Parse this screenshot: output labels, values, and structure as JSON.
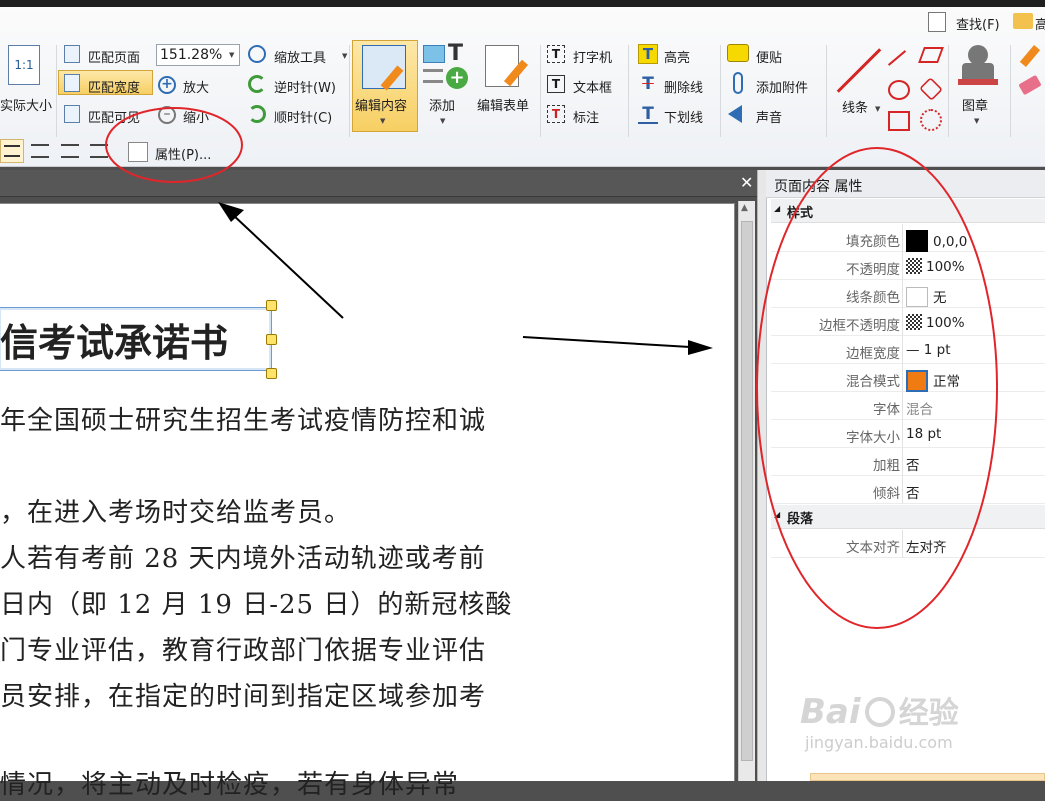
{
  "toolbar": {
    "search_label": "查找(F)",
    "search_next": "高",
    "actual_size": "实际大小",
    "fit_page": "匹配页面",
    "fit_width": "匹配宽度",
    "fit_visible": "匹配可见",
    "zoom_value": "151.28%",
    "zoom_tool": "缩放工具",
    "zoom_in": "放大",
    "zoom_out": "缩小",
    "rotate_ccw": "逆时针(W)",
    "rotate_cw": "顺时针(C)",
    "edit_content": "编辑内容",
    "add": "添加",
    "edit_form": "编辑表单",
    "typewriter": "打字机",
    "textbox": "文本框",
    "callout": "标注",
    "highlight": "高亮",
    "strikeout": "删除线",
    "underline": "下划线",
    "sticky_note": "便贴",
    "attach_file": "添加附件",
    "sound": "声音",
    "line": "线条",
    "stamp": "图章",
    "properties": "属性(P)..."
  },
  "document": {
    "title_text": "信考试承诺书",
    "lines": [
      "年全国硕士研究生招生考试疫情防控和诚",
      "，在进入考场时交给监考员。",
      "人若有考前 28 天内境外活动轨迹或考前",
      "日内（即 12 月 19 日-25 日）的新冠核酸",
      "门专业评估，教育行政部门依据专业评估",
      "员安排，在指定的时间到指定区域参加考",
      "情况，将主动及时检疫，若有身体异常"
    ]
  },
  "panel": {
    "header": "页面内容 属性",
    "section_style": "样式",
    "section_para": "段落",
    "rows": [
      {
        "name": "填充颜色",
        "value": "0,0,0"
      },
      {
        "name": "不透明度",
        "value": "100%"
      },
      {
        "name": "线条颜色",
        "value": "无"
      },
      {
        "name": "边框不透明度",
        "value": "100%"
      },
      {
        "name": "边框宽度",
        "value": "— 1 pt"
      },
      {
        "name": "混合模式",
        "value": "正常"
      },
      {
        "name": "字体",
        "value": "混合"
      },
      {
        "name": "字体大小",
        "value": "18 pt"
      },
      {
        "name": "加粗",
        "value": "否"
      },
      {
        "name": "倾斜",
        "value": "否"
      }
    ],
    "para_rows": [
      {
        "name": "文本对齐",
        "value": "左对齐"
      }
    ]
  },
  "watermark": {
    "brand": "Bai",
    "brand2": "经验",
    "url": "jingyan.baidu.com"
  },
  "colors": {
    "accent": "#f2c14e",
    "annotation_red": "#e0262a",
    "fill_color": "#000000",
    "blend_color": "#f07b12"
  }
}
